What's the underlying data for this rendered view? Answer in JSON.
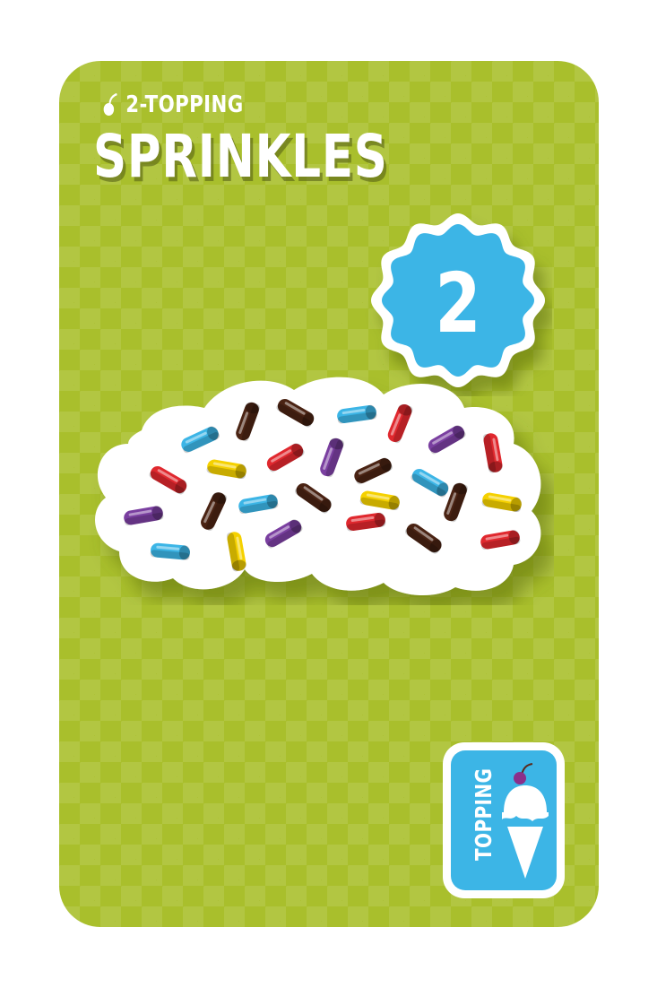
{
  "card": {
    "category": "2-TOPPING",
    "name": "SPRINKLES",
    "value": "2",
    "type_label": "TOPPING",
    "icons": {
      "category": "cherry-icon",
      "type": "ice-cream-cone-icon"
    },
    "colors": {
      "background": "#a9bf2c",
      "badge": "#3cb5e6",
      "text": "#ffffff"
    },
    "sprinkle_colors": [
      "#3cb5e6",
      "#e0282e",
      "#4a2313",
      "#7a3fa0",
      "#f5d100"
    ]
  }
}
